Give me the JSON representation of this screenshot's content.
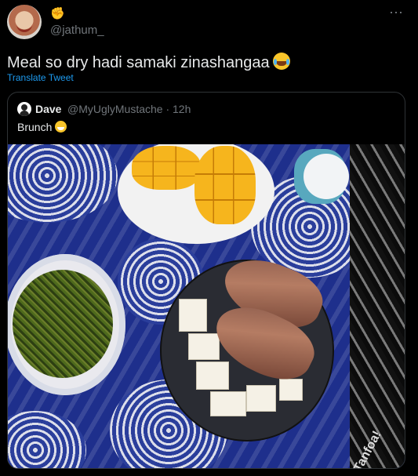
{
  "tweet": {
    "handle": "@jathum_",
    "text": "Meal so dry hadi samaki zinashangaa",
    "translate_label": "Translate Tweet",
    "more_icon": "⋯"
  },
  "quoted_tweet": {
    "author_name": "Dave",
    "author_handle_time": "@MyUglyMustache · 12h",
    "text": "Brunch"
  },
  "photo": {
    "cloth_label": "Tanfoa!"
  }
}
